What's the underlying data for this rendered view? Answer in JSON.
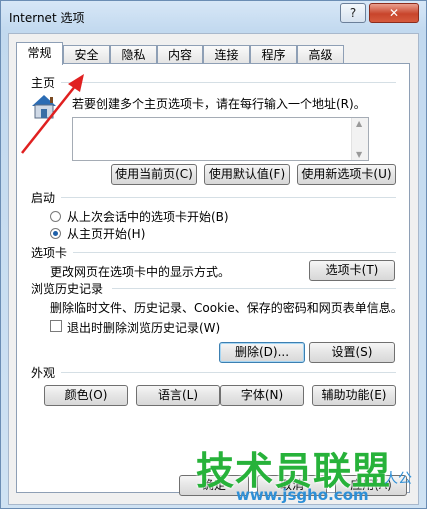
{
  "window": {
    "title": "Internet 选项",
    "help_label": "?",
    "close_label": "✕"
  },
  "tabs": [
    "常规",
    "安全",
    "隐私",
    "内容",
    "连接",
    "程序",
    "高级"
  ],
  "homepage": {
    "group_label": "主页",
    "instruction": "若要创建多个主页选项卡，请在每行输入一个地址(R)。",
    "address_value": "",
    "buttons": {
      "use_current": "使用当前页(C)",
      "use_default": "使用默认值(F)",
      "use_new_tab": "使用新选项卡(U)"
    }
  },
  "startup": {
    "group_label": "启动",
    "option_last_session": "从上次会话中的选项卡开始(B)",
    "option_home": "从主页开始(H)",
    "selected": "option_home"
  },
  "tabs_section": {
    "group_label": "选项卡",
    "description": "更改网页在选项卡中的显示方式。",
    "button": "选项卡(T)"
  },
  "history": {
    "group_label": "浏览历史记录",
    "description": "删除临时文件、历史记录、Cookie、保存的密码和网页表单信息。",
    "checkbox_label": "退出时删除浏览历史记录(W)",
    "checkbox_checked": false,
    "delete_button": "删除(D)...",
    "settings_button": "设置(S)"
  },
  "appearance": {
    "group_label": "外观",
    "colors_button": "颜色(O)",
    "languages_button": "语言(L)",
    "fonts_button": "字体(N)",
    "accessibility_button": "辅助功能(E)"
  },
  "footer": {
    "ok_button": "确定",
    "cancel_button": "取消",
    "apply_button": "应用(A)"
  },
  "overlay": {
    "watermark_text": "技术员联盟",
    "watermark_url": "www.jsgho.com",
    "watermark_extra": "人公",
    "arrow_color": "#e02020"
  }
}
